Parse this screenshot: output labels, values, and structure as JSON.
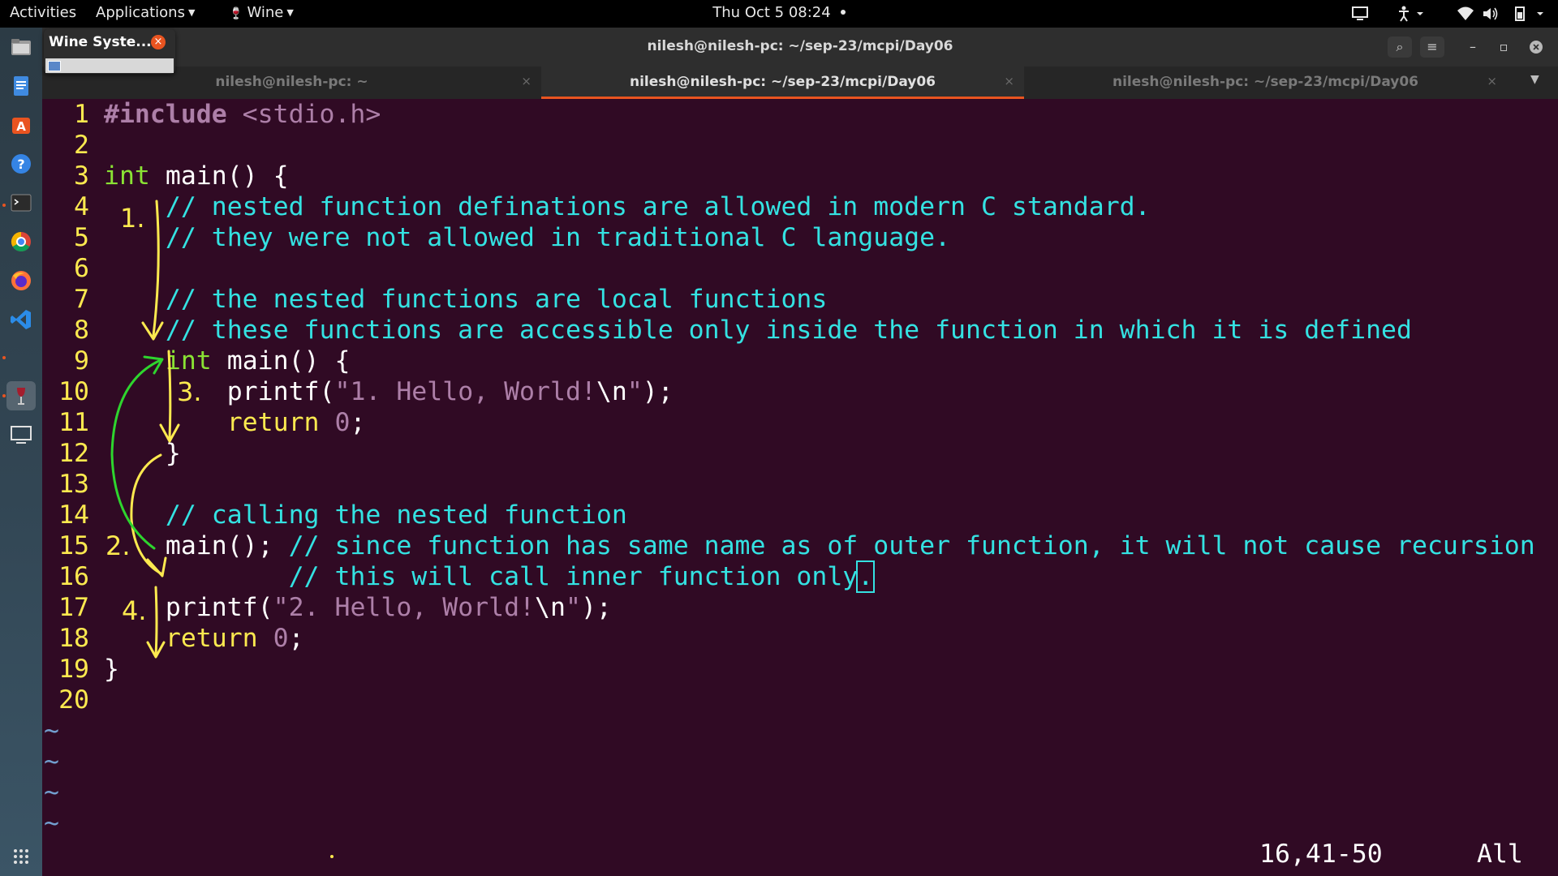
{
  "topbar": {
    "activities": "Activities",
    "applications": "Applications",
    "wine": "Wine",
    "clock": "Thu Oct 5  08:24"
  },
  "dock": {
    "items": [
      "files-icon",
      "text-editor-icon",
      "software-center-icon",
      "help-icon",
      "terminal-icon",
      "chrome-icon",
      "firefox-icon",
      "vscode-icon",
      "wine-glass-icon",
      "display-icon",
      "show-apps-icon"
    ]
  },
  "wine_popup": {
    "title": "Wine Syste..."
  },
  "window": {
    "title": "nilesh@nilesh-pc: ~/sep-23/mcpi/Day06",
    "tabs": [
      {
        "label": "nilesh@nilesh-pc: ~"
      },
      {
        "label": "nilesh@nilesh-pc: ~/sep-23/mcpi/Day06"
      },
      {
        "label": "nilesh@nilesh-pc: ~/sep-23/mcpi/Day06"
      }
    ],
    "close_glyph": "×",
    "min_glyph": "–",
    "max_glyph": "▫",
    "search_glyph": "⌕",
    "menu_glyph": "≡"
  },
  "editor": {
    "line_numbers": [
      "1",
      "2",
      "3",
      "4",
      "5",
      "6",
      "7",
      "8",
      "9",
      "10",
      "11",
      "12",
      "13",
      "14",
      "15",
      "16",
      "17",
      "18",
      "19",
      "20"
    ],
    "l1": {
      "pre": "#include",
      "inc": " <stdio.h>"
    },
    "l3": {
      "type": "int",
      "rest": " main() {"
    },
    "l4": "    // nested function definations are allowed in modern C standard.",
    "l5": "    // they were not allowed in traditional C language.",
    "l7": "    // the nested functions are local functions",
    "l8": "    // these functions are accessible only inside the function in which it is defined",
    "l9": {
      "indent": "    ",
      "type": "int",
      "rest": " main() {"
    },
    "l10": {
      "indent": "        printf(",
      "str1": "\"1. Hello, World!",
      "esc": "\\n",
      "str2": "\"",
      "tail": ");"
    },
    "l11": {
      "indent": "        ",
      "kw": "return",
      "sp": " ",
      "num": "0",
      "tail": ";"
    },
    "l12": "    }",
    "l14": "    // calling the nested function",
    "l15": {
      "code": "    main(); ",
      "cmt": "// since function has same name as of outer function, it will not cause recursion"
    },
    "l16": {
      "cmt": "            // this will call inner function only",
      "cursor": "."
    },
    "l17": {
      "indent": "    printf(",
      "str1": "\"2. Hello, World!",
      "esc": "\\n",
      "str2": "\"",
      "tail": ");"
    },
    "l18": {
      "indent": "    ",
      "kw": "return",
      "sp": " ",
      "num": "0",
      "tail": ";"
    },
    "l19": "}",
    "tilde": "~",
    "ruler": "16,41-50",
    "ruler_all": "All"
  },
  "annotations": {
    "labels": [
      "1.",
      "2.",
      "3.",
      "4."
    ],
    "yellow": "#fce94f",
    "green": "#2ed52e"
  }
}
